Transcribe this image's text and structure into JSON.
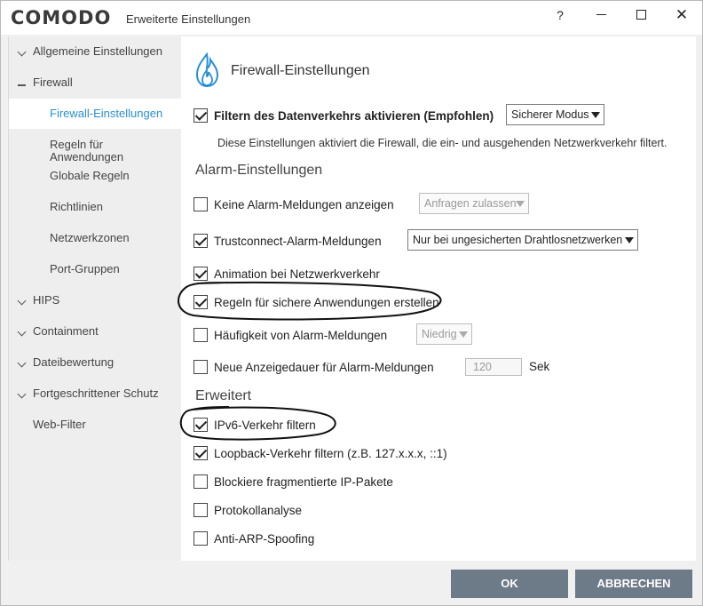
{
  "window": {
    "logo": "COMODO",
    "title": "Erweiterte Einstellungen",
    "help": "?",
    "close": "✕"
  },
  "sidebar": {
    "items": [
      {
        "label": "Allgemeine Einstellungen",
        "icon": "chevron-down-icon"
      },
      {
        "label": "Firewall",
        "icon": "collapse-dash-icon"
      },
      {
        "label": "Firewall-Einstellungen"
      },
      {
        "label": "Regeln für Anwendungen"
      },
      {
        "label": "Globale Regeln"
      },
      {
        "label": "Richtlinien"
      },
      {
        "label": "Netzwerkzonen"
      },
      {
        "label": "Port-Gruppen"
      },
      {
        "label": "HIPS",
        "icon": "chevron-down-icon"
      },
      {
        "label": "Containment",
        "icon": "chevron-down-icon"
      },
      {
        "label": "Dateibewertung",
        "icon": "chevron-down-icon"
      },
      {
        "label": "Fortgeschrittener Schutz",
        "icon": "chevron-down-icon"
      },
      {
        "label": "Web-Filter"
      }
    ]
  },
  "main": {
    "title": "Firewall-Einstellungen",
    "filter": {
      "label": "Filtern des Datenverkehrs aktivieren (Empfohlen)",
      "checked": true,
      "mode": "Sicherer Modus",
      "description": "Diese Einstellungen aktiviert die Firewall, die ein- und ausgehenden Netzwerkverkehr filtert."
    },
    "alarm_section": "Alarm-Einstellungen",
    "alarm": [
      {
        "label": "Keine Alarm-Meldungen anzeigen",
        "checked": false,
        "dropdown": "Anfragen zulassen"
      },
      {
        "label": "Trustconnect-Alarm-Meldungen",
        "checked": true,
        "dropdown": "Nur bei ungesicherten Drahtlosnetzwerken"
      },
      {
        "label": "Animation bei Netzwerkverkehr",
        "checked": true
      },
      {
        "label": "Regeln für sichere Anwendungen erstellen",
        "checked": true
      },
      {
        "label": "Häufigkeit von Alarm-Meldungen",
        "checked": false,
        "dropdown": "Niedrig"
      },
      {
        "label": "Neue Anzeigedauer für Alarm-Meldungen",
        "checked": false,
        "value": "120",
        "unit": "Sek"
      }
    ],
    "advanced_section": "Erweitert",
    "advanced": [
      {
        "label": "IPv6-Verkehr filtern",
        "checked": true
      },
      {
        "label": "Loopback-Verkehr filtern (z.B. 127.x.x.x, ::1)",
        "checked": true
      },
      {
        "label": "Blockiere fragmentierte IP-Pakete",
        "checked": false
      },
      {
        "label": "Protokollanalyse",
        "checked": false
      },
      {
        "label": "Anti-ARP-Spoofing",
        "checked": false
      }
    ]
  },
  "buttons": {
    "ok": "OK",
    "cancel": "ABBRECHEN"
  },
  "colors": {
    "accent": "#2a8fd6",
    "button": "#6d7a88"
  }
}
